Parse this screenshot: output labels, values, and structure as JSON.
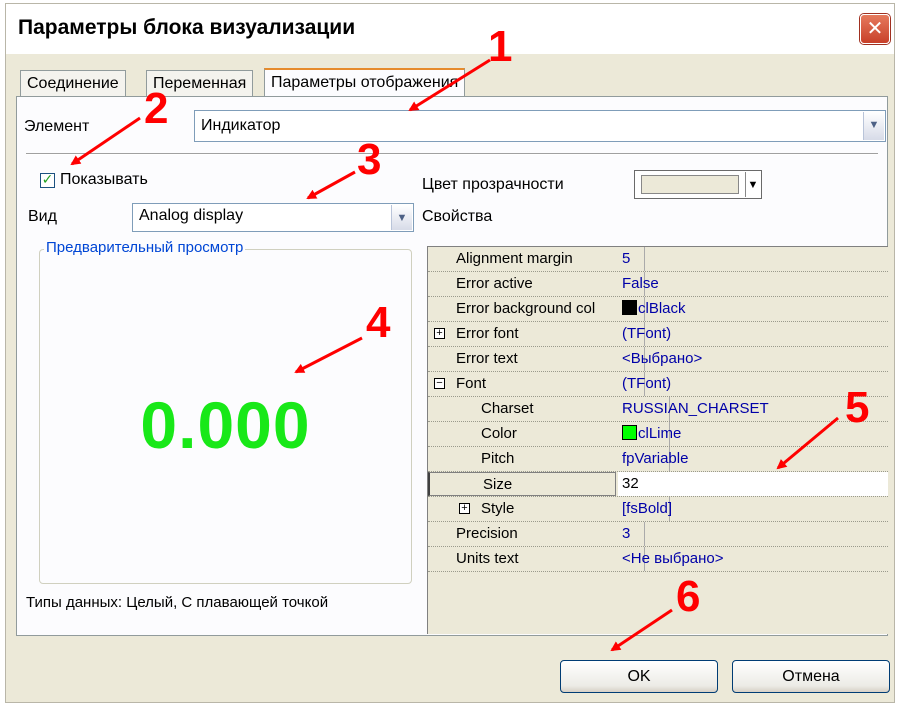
{
  "window": {
    "title": "Параметры блока визуализации",
    "close_glyph": "✕"
  },
  "tabs": [
    {
      "label": "Соединение"
    },
    {
      "label": "Переменная"
    },
    {
      "label": "Параметры отображения"
    }
  ],
  "element": {
    "label": "Элемент",
    "value": "Индикатор"
  },
  "show": {
    "label": "Показывать",
    "checked": true
  },
  "view": {
    "label": "Вид",
    "value": "Analog display"
  },
  "transparency": {
    "label": "Цвет прозрачности",
    "color": "#ece9d8"
  },
  "properties_label": "Свойства",
  "preview": {
    "legend": "Предварительный просмотр",
    "value": "0.000",
    "color": "#18e818"
  },
  "data_types": "Типы данных: Целый, С плавающей точкой",
  "inspector": {
    "rows": [
      {
        "name": "Alignment margin",
        "value": "5"
      },
      {
        "name": "Error active",
        "value": "False"
      },
      {
        "name": "Error background col",
        "value": "clBlack",
        "swatch": "#000000"
      },
      {
        "name": "Error font",
        "value": "(TFont)",
        "expander": "+"
      },
      {
        "name": "Error text",
        "value": "<Выбрано>"
      },
      {
        "name": "Font",
        "value": "(TFont)",
        "expander": "−"
      },
      {
        "name": "Charset",
        "value": "RUSSIAN_CHARSET"
      },
      {
        "name": "Color",
        "value": "clLime",
        "swatch": "#00ff00"
      },
      {
        "name": "Pitch",
        "value": "fpVariable"
      },
      {
        "name": "Size",
        "value": "32"
      },
      {
        "name": "Style",
        "value": "[fsBold]",
        "expander": "+"
      },
      {
        "name": "Precision",
        "value": "3"
      },
      {
        "name": "Units text",
        "value": "<Не выбрано>"
      }
    ]
  },
  "buttons": {
    "ok": "OK",
    "cancel": "Отмена"
  },
  "annotations": [
    "1",
    "2",
    "3",
    "4",
    "5",
    "6"
  ],
  "colors": {
    "annotation": "#ff0000",
    "link_blue": "#0046d5"
  }
}
